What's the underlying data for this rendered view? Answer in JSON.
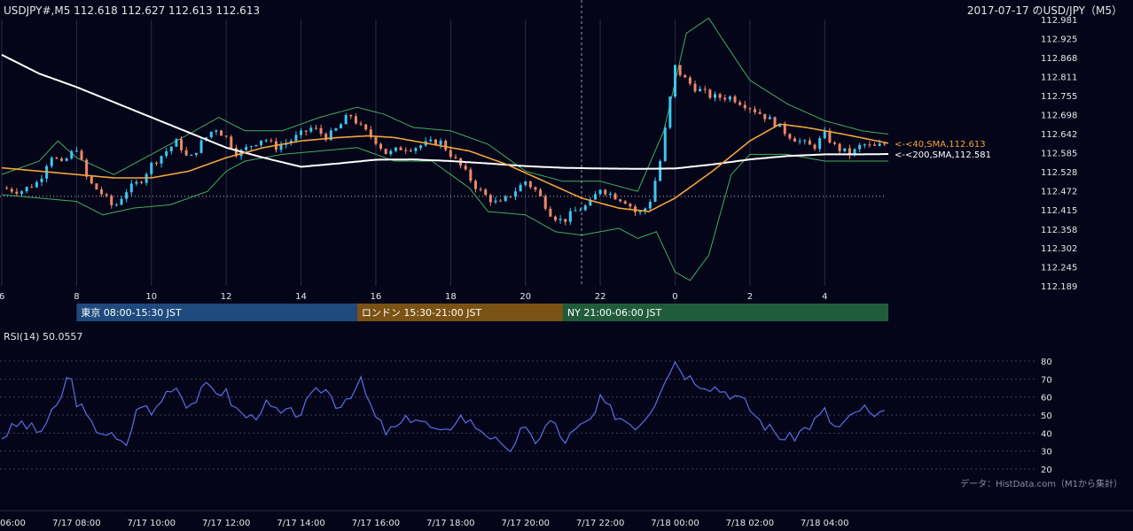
{
  "header": {
    "symbol_readout": "USDJPY#,M5 112.618 112.627 112.613 112.613",
    "chart_title": "2017-07-17 のUSD/JPY（M5）"
  },
  "colors": {
    "background": "#050519",
    "grid": "#2a2d48",
    "candle_up": "#3ec6f0",
    "candle_down": "#ee8866",
    "sma40": "#f2a53a",
    "sma200": "#ffffff",
    "bollinger": "#3fae5c",
    "rsi": "#5a6ee8",
    "session_tokyo": "#1e4a7e",
    "session_london": "#7a5214",
    "session_ny": "#215c3a"
  },
  "chart_data": [
    {
      "type": "candlestick",
      "y_ticks": [
        "112.981",
        "112.925",
        "112.868",
        "112.811",
        "112.755",
        "112.698",
        "112.642",
        "112.585",
        "112.528",
        "112.472",
        "112.415",
        "112.358",
        "112.302",
        "112.245",
        "112.189"
      ],
      "ylim": [
        112.189,
        112.981
      ],
      "x_ticks": [
        "6",
        "8",
        "10",
        "12",
        "14",
        "16",
        "18",
        "20",
        "22",
        "0",
        "2",
        "4"
      ],
      "x_range_hours": [
        6,
        29.7
      ],
      "dotted_level": 112.455,
      "day_separator_hour": 21.5,
      "price_path": [
        [
          6.0,
          112.48
        ],
        [
          6.5,
          112.47
        ],
        [
          7.0,
          112.5
        ],
        [
          7.3,
          112.58
        ],
        [
          7.6,
          112.55
        ],
        [
          8.0,
          112.6
        ],
        [
          8.3,
          112.5
        ],
        [
          8.7,
          112.46
        ],
        [
          9.0,
          112.42
        ],
        [
          9.3,
          112.47
        ],
        [
          9.7,
          112.5
        ],
        [
          10.0,
          112.55
        ],
        [
          10.3,
          112.58
        ],
        [
          10.7,
          112.62
        ],
        [
          11.0,
          112.56
        ],
        [
          11.3,
          112.61
        ],
        [
          11.7,
          112.66
        ],
        [
          12.0,
          112.63
        ],
        [
          12.3,
          112.58
        ],
        [
          12.7,
          112.61
        ],
        [
          13.0,
          112.63
        ],
        [
          13.3,
          112.6
        ],
        [
          13.7,
          112.62
        ],
        [
          14.0,
          112.64
        ],
        [
          14.3,
          112.66
        ],
        [
          14.7,
          112.63
        ],
        [
          15.0,
          112.66
        ],
        [
          15.3,
          112.7
        ],
        [
          15.6,
          112.66
        ],
        [
          16.0,
          112.62
        ],
        [
          16.3,
          112.58
        ],
        [
          16.7,
          112.6
        ],
        [
          17.0,
          112.6
        ],
        [
          17.3,
          112.61
        ],
        [
          17.7,
          112.62
        ],
        [
          18.0,
          112.58
        ],
        [
          18.3,
          112.54
        ],
        [
          18.7,
          112.48
        ],
        [
          19.0,
          112.45
        ],
        [
          19.3,
          112.43
        ],
        [
          19.7,
          112.47
        ],
        [
          20.0,
          112.5
        ],
        [
          20.3,
          112.47
        ],
        [
          20.7,
          112.4
        ],
        [
          21.0,
          112.38
        ],
        [
          21.3,
          112.41
        ],
        [
          21.7,
          112.43
        ],
        [
          22.0,
          112.48
        ],
        [
          22.3,
          112.46
        ],
        [
          22.7,
          112.44
        ],
        [
          23.0,
          112.4
        ],
        [
          23.3,
          112.43
        ],
        [
          23.6,
          112.56
        ],
        [
          23.8,
          112.7
        ],
        [
          24.0,
          112.84
        ],
        [
          24.2,
          112.81
        ],
        [
          24.5,
          112.78
        ],
        [
          25.0,
          112.75
        ],
        [
          25.5,
          112.75
        ],
        [
          26.0,
          112.72
        ],
        [
          26.3,
          112.7
        ],
        [
          26.7,
          112.67
        ],
        [
          27.0,
          112.64
        ],
        [
          27.3,
          112.62
        ],
        [
          27.7,
          112.6
        ],
        [
          28.0,
          112.64
        ],
        [
          28.3,
          112.6
        ],
        [
          28.7,
          112.58
        ],
        [
          29.0,
          112.61
        ],
        [
          29.3,
          112.6
        ],
        [
          29.7,
          112.613
        ]
      ],
      "sma40_path": [
        [
          6.0,
          112.54
        ],
        [
          7.0,
          112.53
        ],
        [
          8.0,
          112.52
        ],
        [
          9.0,
          112.51
        ],
        [
          10.0,
          112.51
        ],
        [
          11.0,
          112.53
        ],
        [
          12.0,
          112.57
        ],
        [
          13.0,
          112.6
        ],
        [
          14.0,
          112.62
        ],
        [
          15.0,
          112.63
        ],
        [
          15.8,
          112.635
        ],
        [
          16.5,
          112.63
        ],
        [
          17.5,
          112.61
        ],
        [
          18.5,
          112.59
        ],
        [
          19.5,
          112.55
        ],
        [
          20.5,
          112.5
        ],
        [
          21.5,
          112.45
        ],
        [
          22.5,
          112.42
        ],
        [
          23.3,
          112.41
        ],
        [
          24.0,
          112.45
        ],
        [
          25.0,
          112.53
        ],
        [
          26.0,
          112.62
        ],
        [
          26.8,
          112.67
        ],
        [
          27.5,
          112.66
        ],
        [
          28.5,
          112.64
        ],
        [
          29.7,
          112.613
        ]
      ],
      "sma200_path": [
        [
          6.0,
          112.876
        ],
        [
          7.0,
          112.82
        ],
        [
          8.0,
          112.78
        ],
        [
          9.0,
          112.735
        ],
        [
          10.0,
          112.69
        ],
        [
          11.0,
          112.645
        ],
        [
          12.0,
          112.6
        ],
        [
          13.0,
          112.57
        ],
        [
          14.0,
          112.543
        ],
        [
          15.0,
          112.553
        ],
        [
          16.0,
          112.564
        ],
        [
          17.0,
          112.565
        ],
        [
          18.0,
          112.56
        ],
        [
          19.0,
          112.553
        ],
        [
          20.0,
          112.545
        ],
        [
          21.0,
          112.54
        ],
        [
          22.0,
          112.538
        ],
        [
          23.0,
          112.537
        ],
        [
          24.0,
          112.538
        ],
        [
          25.0,
          112.55
        ],
        [
          26.0,
          112.565
        ],
        [
          27.0,
          112.575
        ],
        [
          28.0,
          112.58
        ],
        [
          29.0,
          112.58
        ],
        [
          29.7,
          112.581
        ]
      ],
      "bb_upper_path": [
        [
          6.0,
          112.52
        ],
        [
          7.0,
          112.56
        ],
        [
          7.5,
          112.62
        ],
        [
          8.0,
          112.57
        ],
        [
          9.0,
          112.52
        ],
        [
          10.0,
          112.58
        ],
        [
          11.0,
          112.64
        ],
        [
          11.8,
          112.69
        ],
        [
          12.5,
          112.65
        ],
        [
          13.5,
          112.65
        ],
        [
          14.5,
          112.69
        ],
        [
          15.5,
          112.72
        ],
        [
          16.2,
          112.7
        ],
        [
          17.0,
          112.66
        ],
        [
          18.0,
          112.65
        ],
        [
          19.0,
          112.61
        ],
        [
          20.0,
          112.53
        ],
        [
          21.0,
          112.5
        ],
        [
          22.0,
          112.5
        ],
        [
          23.0,
          112.47
        ],
        [
          23.7,
          112.65
        ],
        [
          24.3,
          112.94
        ],
        [
          24.9,
          112.985
        ],
        [
          25.4,
          112.9
        ],
        [
          26.0,
          112.8
        ],
        [
          27.0,
          112.73
        ],
        [
          28.0,
          112.68
        ],
        [
          29.0,
          112.65
        ],
        [
          29.7,
          112.64
        ]
      ],
      "bb_lower_path": [
        [
          6.0,
          112.46
        ],
        [
          7.0,
          112.45
        ],
        [
          8.0,
          112.44
        ],
        [
          8.7,
          112.4
        ],
        [
          9.5,
          112.42
        ],
        [
          10.5,
          112.43
        ],
        [
          11.5,
          112.47
        ],
        [
          12.0,
          112.53
        ],
        [
          12.5,
          112.56
        ],
        [
          13.5,
          112.58
        ],
        [
          14.5,
          112.59
        ],
        [
          15.5,
          112.6
        ],
        [
          16.5,
          112.56
        ],
        [
          17.5,
          112.56
        ],
        [
          18.5,
          112.48
        ],
        [
          19.0,
          112.41
        ],
        [
          20.0,
          112.4
        ],
        [
          20.8,
          112.35
        ],
        [
          21.5,
          112.34
        ],
        [
          22.5,
          112.36
        ],
        [
          23.0,
          112.33
        ],
        [
          23.5,
          112.35
        ],
        [
          24.0,
          112.23
        ],
        [
          24.4,
          112.205
        ],
        [
          24.9,
          112.28
        ],
        [
          25.5,
          112.52
        ],
        [
          26.0,
          112.58
        ],
        [
          27.0,
          112.58
        ],
        [
          28.0,
          112.56
        ],
        [
          29.0,
          112.56
        ],
        [
          29.7,
          112.56
        ]
      ],
      "annotations": [
        {
          "text": "<-<40,SMA,112.613",
          "price": 112.613,
          "color": "#f2a53a"
        },
        {
          "text": "<-<200,SMA,112.581",
          "price": 112.581,
          "color": "#ffffff"
        }
      ],
      "sessions": [
        {
          "label": "東京 08:00-15:30 JST",
          "start": 8.0,
          "end": 15.5,
          "color": "#1e4a7e"
        },
        {
          "label": "ロンドン 15:30-21:00 JST",
          "start": 15.5,
          "end": 21.0,
          "color": "#7a5214"
        },
        {
          "label": "NY 21:00-06:00 JST",
          "start": 21.0,
          "end": 29.7,
          "color": "#215c3a"
        }
      ]
    },
    {
      "type": "line",
      "title": "RSI(14) 50.0557",
      "y_ticks": [
        "80",
        "70",
        "60",
        "50",
        "40",
        "30",
        "20"
      ],
      "ylim": [
        20,
        80
      ],
      "rsi_path": [
        [
          6.0,
          38
        ],
        [
          6.5,
          46
        ],
        [
          7.0,
          40
        ],
        [
          7.5,
          55
        ],
        [
          7.8,
          74
        ],
        [
          8.0,
          58
        ],
        [
          8.4,
          44
        ],
        [
          8.8,
          40
        ],
        [
          9.3,
          32
        ],
        [
          9.7,
          58
        ],
        [
          10.0,
          50
        ],
        [
          10.3,
          60
        ],
        [
          10.6,
          68
        ],
        [
          11.0,
          55
        ],
        [
          11.5,
          66
        ],
        [
          12.0,
          62
        ],
        [
          12.3,
          52
        ],
        [
          12.7,
          48
        ],
        [
          13.0,
          56
        ],
        [
          13.5,
          50
        ],
        [
          14.0,
          52
        ],
        [
          14.3,
          60
        ],
        [
          14.6,
          66
        ],
        [
          15.0,
          55
        ],
        [
          15.4,
          64
        ],
        [
          15.6,
          68
        ],
        [
          16.0,
          48
        ],
        [
          16.3,
          40
        ],
        [
          16.7,
          45
        ],
        [
          17.0,
          50
        ],
        [
          17.4,
          44
        ],
        [
          17.8,
          38
        ],
        [
          18.2,
          50
        ],
        [
          18.6,
          45
        ],
        [
          19.0,
          40
        ],
        [
          19.5,
          28
        ],
        [
          19.9,
          42
        ],
        [
          20.3,
          36
        ],
        [
          20.7,
          48
        ],
        [
          21.0,
          35
        ],
        [
          21.4,
          42
        ],
        [
          21.8,
          48
        ],
        [
          22.0,
          58
        ],
        [
          22.3,
          52
        ],
        [
          22.6,
          48
        ],
        [
          23.0,
          44
        ],
        [
          23.4,
          55
        ],
        [
          23.7,
          70
        ],
        [
          24.0,
          80
        ],
        [
          24.3,
          72
        ],
        [
          24.7,
          68
        ],
        [
          25.0,
          66
        ],
        [
          25.5,
          62
        ],
        [
          25.9,
          56
        ],
        [
          26.3,
          46
        ],
        [
          26.7,
          40
        ],
        [
          27.0,
          36
        ],
        [
          27.3,
          40
        ],
        [
          27.7,
          46
        ],
        [
          28.0,
          52
        ],
        [
          28.3,
          42
        ],
        [
          28.7,
          48
        ],
        [
          29.0,
          55
        ],
        [
          29.3,
          48
        ],
        [
          29.7,
          50.06
        ]
      ]
    }
  ],
  "time_axis": {
    "labels": [
      "06:00",
      "7/17 08:00",
      "7/17 10:00",
      "7/17 12:00",
      "7/17 14:00",
      "7/17 16:00",
      "7/17 18:00",
      "7/17 20:00",
      "7/17 22:00",
      "7/18 00:00",
      "7/18 02:00",
      "7/18 04:00"
    ],
    "hours": [
      6,
      8,
      10,
      12,
      14,
      16,
      18,
      20,
      22,
      24,
      26,
      28
    ]
  },
  "footer": {
    "source": "データ：HistData.com（M1から集計）"
  }
}
